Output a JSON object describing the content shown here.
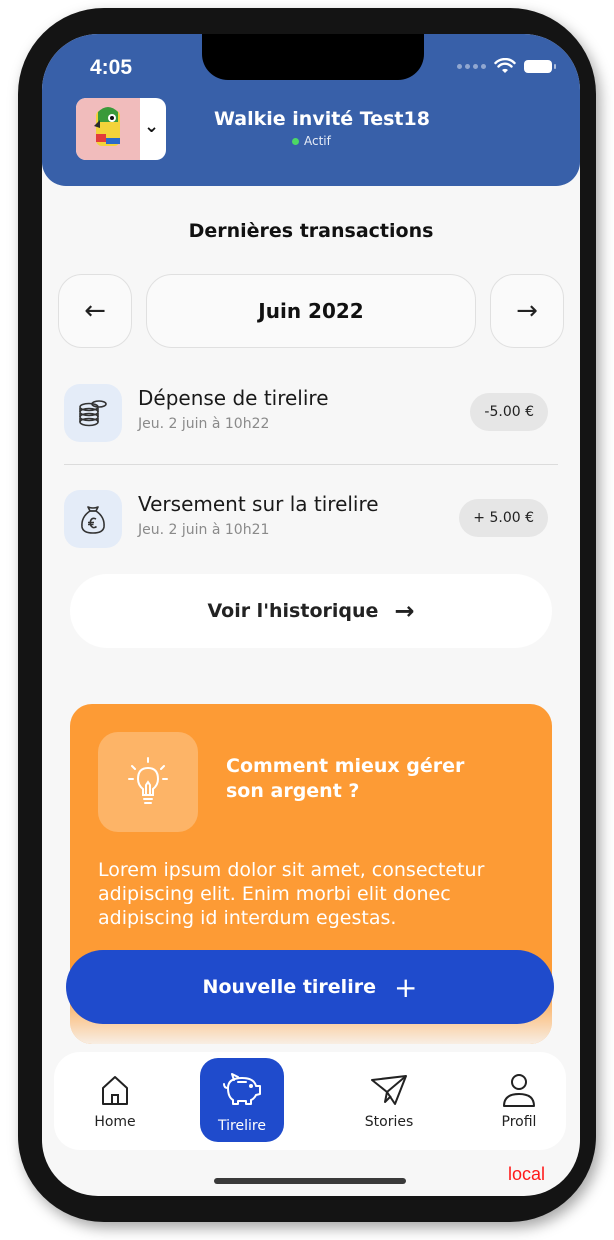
{
  "status_bar": {
    "time": "4:05"
  },
  "header": {
    "account_name": "Walkie invité Test18",
    "account_status": "Actif"
  },
  "transactions": {
    "title": "Dernières transactions",
    "month": "Juin 2022",
    "prev_label": "←",
    "next_label": "→",
    "items": [
      {
        "title": "Dépense de tirelire",
        "date": "Jeu. 2 juin à 10h22",
        "amount": "-5.00 €",
        "icon": "coins-stack-icon"
      },
      {
        "title": "Versement sur la tirelire",
        "date": "Jeu. 2 juin à 10h21",
        "amount": "+ 5.00 €",
        "icon": "money-bag-euro-icon"
      }
    ],
    "history_label": "Voir l'historique",
    "history_arrow": "→"
  },
  "tip": {
    "title": "Comment mieux gérer son argent ?",
    "body": "Lorem ipsum dolor sit amet, consectetur adipiscing elit. Enim morbi elit donec adipiscing id interdum egestas."
  },
  "cta": {
    "label": "Nouvelle tirelire",
    "plus": "+"
  },
  "tabbar": {
    "items": [
      {
        "label": "Home",
        "icon": "home-icon"
      },
      {
        "label": "Tirelire",
        "icon": "piggy-bank-icon"
      },
      {
        "label": "Stories",
        "icon": "paper-plane-icon"
      },
      {
        "label": "Profil",
        "icon": "user-icon"
      }
    ],
    "active": "Tirelire"
  },
  "env_label": "local",
  "colors": {
    "header": "#3860a9",
    "primary": "#1f4bcc",
    "tip": "#fd9b35"
  }
}
